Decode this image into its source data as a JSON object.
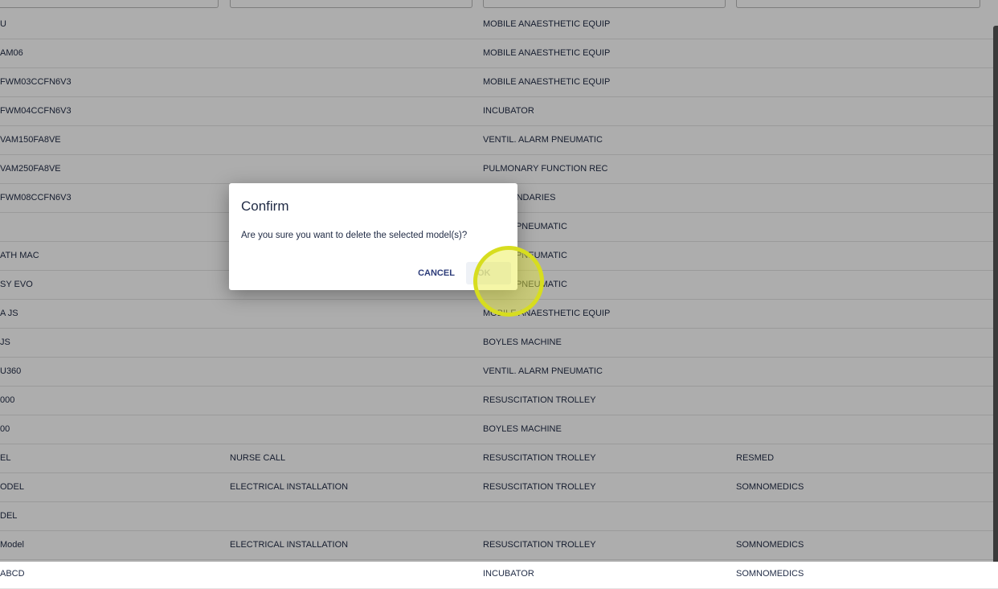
{
  "table": {
    "rows": [
      {
        "col1": "U",
        "col2": "",
        "col3": "MOBILE ANAESTHETIC EQUIP",
        "col4": ""
      },
      {
        "col1": "AM06",
        "col2": "",
        "col3": "MOBILE ANAESTHETIC EQUIP",
        "col4": ""
      },
      {
        "col1": "FWM03CCFN6V3",
        "col2": "",
        "col3": "MOBILE ANAESTHETIC EQUIP",
        "col4": ""
      },
      {
        "col1": "FWM04CCFN6V3",
        "col2": "",
        "col3": "INCUBATOR",
        "col4": ""
      },
      {
        "col1": "VAM150FA8VE",
        "col2": "",
        "col3": "VENTIL. ALARM PNEUMATIC",
        "col4": ""
      },
      {
        "col1": "VAM250FA8VE",
        "col2": "",
        "col3": "PULMONARY FUNCTION REC",
        "col4": ""
      },
      {
        "col1": "FWM08CCFN6V3",
        "col2": "",
        "col3": "E SECONDARIES",
        "col4": ""
      },
      {
        "col1": "",
        "col2": "",
        "col3": "ALARM PNEUMATIC",
        "col4": ""
      },
      {
        "col1": "ATH MAC",
        "col2": "",
        "col3": "ALARM PNEUMATIC",
        "col4": ""
      },
      {
        "col1": "SY EVO",
        "col2": "",
        "col3": "ALARM PNEUMATIC",
        "col4": ""
      },
      {
        "col1": "A JS",
        "col2": "",
        "col3": "MOBILE ANAESTHETIC EQUIP",
        "col4": ""
      },
      {
        "col1": "JS",
        "col2": "",
        "col3": "BOYLES MACHINE",
        "col4": ""
      },
      {
        "col1": "U360",
        "col2": "",
        "col3": "VENTIL. ALARM PNEUMATIC",
        "col4": ""
      },
      {
        "col1": "000",
        "col2": "",
        "col3": "RESUSCITATION TROLLEY",
        "col4": ""
      },
      {
        "col1": "00",
        "col2": "",
        "col3": "BOYLES MACHINE",
        "col4": ""
      },
      {
        "col1": "EL",
        "col2": "NURSE CALL",
        "col3": "RESUSCITATION TROLLEY",
        "col4": "RESMED"
      },
      {
        "col1": "ODEL",
        "col2": "ELECTRICAL INSTALLATION",
        "col3": "RESUSCITATION TROLLEY",
        "col4": "SOMNOMEDICS"
      },
      {
        "col1": "DEL",
        "col2": "",
        "col3": "",
        "col4": ""
      },
      {
        "col1": "Model",
        "col2": "ELECTRICAL INSTALLATION",
        "col3": "RESUSCITATION TROLLEY",
        "col4": "SOMNOMEDICS"
      },
      {
        "col1": "ABCD",
        "col2": "",
        "col3": "INCUBATOR",
        "col4": "SOMNOMEDICS"
      }
    ]
  },
  "dialog": {
    "title": "Confirm",
    "message": "Are you sure you want to delete the selected model(s)?",
    "cancel_label": "CANCEL",
    "ok_label": "OK"
  },
  "colors": {
    "text": "#1f2a44",
    "primary_button_text": "#2d3c7a",
    "click_highlight": "#d7dd1f"
  }
}
